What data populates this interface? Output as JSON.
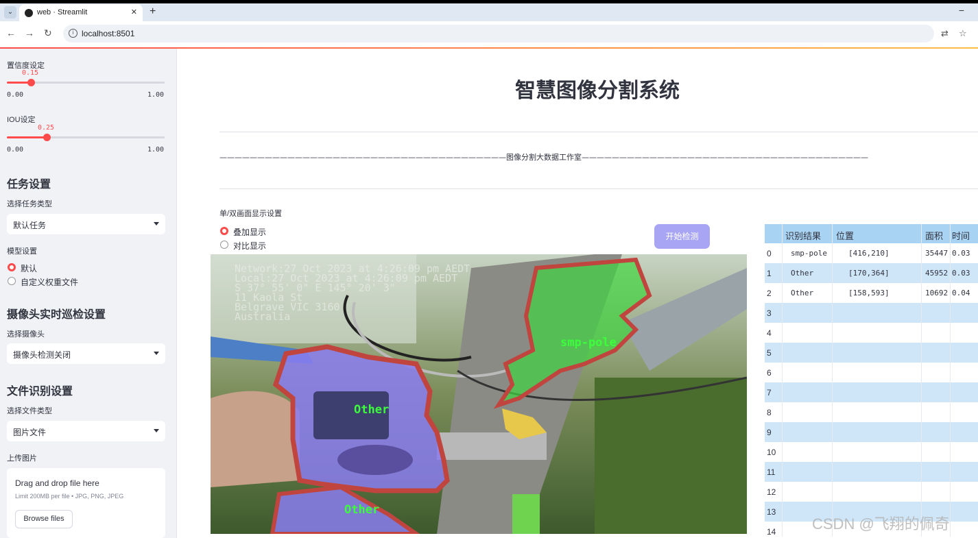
{
  "browser": {
    "tab_title": "web · Streamlit",
    "tab_close": "✕",
    "new_tab": "+",
    "url": "localhost:8501",
    "minimize": "−",
    "back": "←",
    "forward": "→",
    "reload": "↻",
    "translate_icon": "⇄",
    "star_icon": "☆"
  },
  "sidebar": {
    "confidence": {
      "label": "置信度设定",
      "value": "0.15",
      "min": "0.00",
      "max": "1.00",
      "level": 0.15
    },
    "iou": {
      "label": "IOU设定",
      "value": "0.25",
      "min": "0.00",
      "max": "1.00",
      "level": 0.25
    },
    "task": {
      "heading": "任务设置",
      "label": "选择任务类型",
      "selected": "默认任务"
    },
    "model": {
      "label": "模型设置",
      "options": [
        "默认",
        "自定义权重文件"
      ],
      "selected_index": 0
    },
    "camera": {
      "heading": "摄像头实时巡检设置",
      "label": "选择摄像头",
      "selected": "摄像头检测关闭"
    },
    "file": {
      "heading": "文件识别设置",
      "label": "选择文件类型",
      "selected": "图片文件"
    },
    "upload": {
      "label": "上传图片",
      "title": "Drag and drop file here",
      "limit": "Limit 200MB per file • JPG, PNG, JPEG",
      "button": "Browse files"
    }
  },
  "main": {
    "title": "智慧图像分割系统",
    "studio": "——————————————————————————————————————图像分割大数据工作室——————————————————————————————————————",
    "display_label": "单/双画面显示设置",
    "display_options": [
      "叠加显示",
      "对比显示"
    ],
    "display_selected": 0,
    "start_button": "开始检测"
  },
  "image": {
    "overlay_text": [
      "Network:27 Oct 2023 at 4:26:09 pm AEDT",
      "Local:27 Oct 2023 at 4:26:09 pm AEDT",
      "S 37° 55' 0\"  E 145° 20' 3\"",
      "11 Kaola St",
      "Belgrave VIC 3160",
      "Australia"
    ],
    "labels": [
      "smp-pole",
      "Other",
      "Other"
    ]
  },
  "table": {
    "headers": [
      "识别结果",
      "位置",
      "面积",
      "时间"
    ],
    "rows": [
      {
        "index": "0",
        "result": "smp-pole",
        "position": "[416,210]",
        "area": "35447",
        "time": "0.03"
      },
      {
        "index": "1",
        "result": "Other",
        "position": "[170,364]",
        "area": "45952",
        "time": "0.03"
      },
      {
        "index": "2",
        "result": "Other",
        "position": "[158,593]",
        "area": "10692",
        "time": "0.04"
      },
      {
        "index": "3"
      },
      {
        "index": "4"
      },
      {
        "index": "5"
      },
      {
        "index": "6"
      },
      {
        "index": "7"
      },
      {
        "index": "8"
      },
      {
        "index": "9"
      },
      {
        "index": "10"
      },
      {
        "index": "11"
      },
      {
        "index": "12"
      },
      {
        "index": "13"
      },
      {
        "index": "14"
      }
    ]
  },
  "watermark": "CSDN @飞翔的佩奇"
}
